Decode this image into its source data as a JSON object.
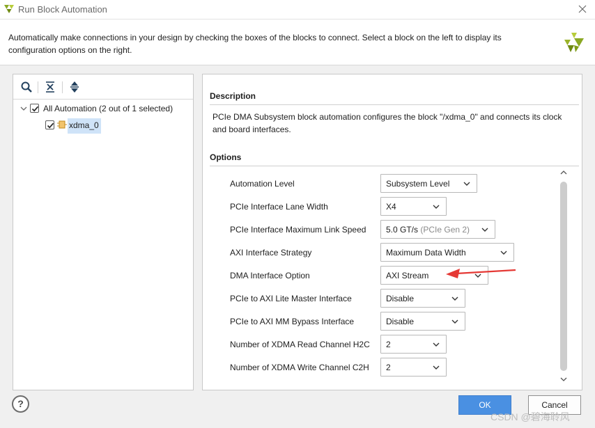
{
  "window": {
    "title": "Run Block Automation",
    "icon": "vivado-logo-icon"
  },
  "header": {
    "description": "Automatically make connections in your design by checking the boxes of the blocks to connect. Select a block on the left to display its configuration options on the right."
  },
  "tree": {
    "toolbar": [
      "search-icon",
      "collapse-all-icon",
      "expand-all-icon"
    ],
    "root": {
      "label": "All Automation (2 out of 1 selected)",
      "checked": true
    },
    "items": [
      {
        "label": "xdma_0",
        "checked": true,
        "selected": true
      }
    ]
  },
  "details": {
    "description_heading": "Description",
    "description_text": "PCIe DMA Subsystem block automation configures the block \"/xdma_0\" and connects its clock and board interfaces.",
    "options_heading": "Options",
    "options": [
      {
        "label": "Automation Level",
        "value": "Subsystem Level"
      },
      {
        "label": "PCIe Interface Lane Width",
        "value": "X4"
      },
      {
        "label": "PCIe Interface Maximum Link Speed",
        "value": "5.0 GT/s",
        "value_note": "(PCIe Gen 2)"
      },
      {
        "label": "AXI Interface Strategy",
        "value": "Maximum Data Width"
      },
      {
        "label": "DMA Interface Option",
        "value": "AXI Stream"
      },
      {
        "label": "PCIe to AXI Lite Master Interface",
        "value": "Disable"
      },
      {
        "label": "PCIe to AXI MM Bypass Interface",
        "value": "Disable"
      },
      {
        "label": "Number of XDMA Read Channel H2C",
        "value": "2"
      },
      {
        "label": "Number of XDMA Write Channel C2H",
        "value": "2"
      }
    ]
  },
  "footer": {
    "help_label": "?",
    "ok_label": "OK",
    "cancel_label": "Cancel"
  },
  "watermark": "CSDN @碧海聆风",
  "colors": {
    "accent": "#4a90e2",
    "annotation_arrow": "#e53935",
    "selection": "#cfe3f8"
  }
}
